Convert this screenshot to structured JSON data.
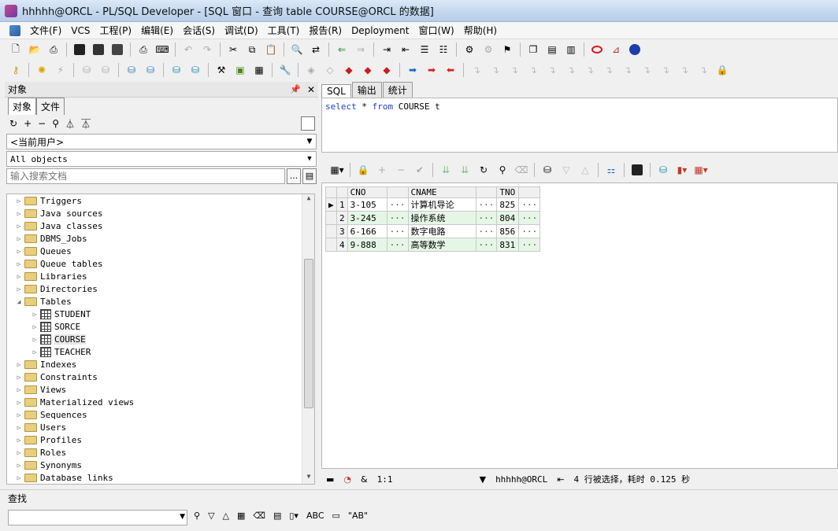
{
  "window": {
    "title": "hhhhh@ORCL - PL/SQL Developer - [SQL 窗口 - 查询 table COURSE@ORCL 的数据]"
  },
  "menu": [
    "文件(F)",
    "VCS",
    "工程(P)",
    "编辑(E)",
    "会话(S)",
    "调试(D)",
    "工具(T)",
    "报告(R)",
    "Deployment",
    "窗口(W)",
    "帮助(H)"
  ],
  "left_panel": {
    "title": "对象",
    "tabs": [
      "对象",
      "文件"
    ],
    "user_dropdown": "<当前用户>",
    "filter_dropdown": "All objects",
    "search_placeholder": "输入搜索文档",
    "search_btn": "...",
    "tree": [
      {
        "label": "Triggers",
        "expanded": false
      },
      {
        "label": "Java sources",
        "expanded": false
      },
      {
        "label": "Java classes",
        "expanded": false
      },
      {
        "label": "DBMS_Jobs",
        "expanded": false
      },
      {
        "label": "Queues",
        "expanded": false
      },
      {
        "label": "Queue tables",
        "expanded": false
      },
      {
        "label": "Libraries",
        "expanded": false
      },
      {
        "label": "Directories",
        "expanded": false
      },
      {
        "label": "Tables",
        "expanded": true
      },
      {
        "label": "STUDENT",
        "child": true
      },
      {
        "label": "SORCE",
        "child": true
      },
      {
        "label": "COURSE",
        "child": true
      },
      {
        "label": "TEACHER",
        "child": true
      },
      {
        "label": "Indexes",
        "expanded": false
      },
      {
        "label": "Constraints",
        "expanded": false
      },
      {
        "label": "Views",
        "expanded": false
      },
      {
        "label": "Materialized views",
        "expanded": false
      },
      {
        "label": "Sequences",
        "expanded": false
      },
      {
        "label": "Users",
        "expanded": false
      },
      {
        "label": "Profiles",
        "expanded": false
      },
      {
        "label": "Roles",
        "expanded": false
      },
      {
        "label": "Synonyms",
        "expanded": false
      },
      {
        "label": "Database links",
        "expanded": false
      }
    ]
  },
  "sql_tabs": [
    "SQL",
    "输出",
    "统计"
  ],
  "editor": {
    "kw1": "select",
    "mid": " * ",
    "kw2": "from",
    "rest": " COURSE t"
  },
  "grid": {
    "columns": [
      "CNO",
      "CNAME",
      "TNO"
    ],
    "rows": [
      {
        "num": "1",
        "cno": "3-105",
        "cname": "计算机导论",
        "tno": "825"
      },
      {
        "num": "2",
        "cno": "3-245",
        "cname": "操作系统",
        "tno": "804"
      },
      {
        "num": "3",
        "cno": "6-166",
        "cname": "数字电路",
        "tno": "856"
      },
      {
        "num": "4",
        "cno": "9-888",
        "cname": "高等数学",
        "tno": "831"
      }
    ],
    "ellipsis": "···",
    "current_row_marker": "▶"
  },
  "status": {
    "position": "1:1",
    "connection": "hhhhh@ORCL",
    "message": "4 行被选择，耗时 0.125 秒",
    "amp": "&"
  },
  "find": {
    "label": "查找",
    "abc1": "ABC",
    "abc2": "\"AB\""
  }
}
